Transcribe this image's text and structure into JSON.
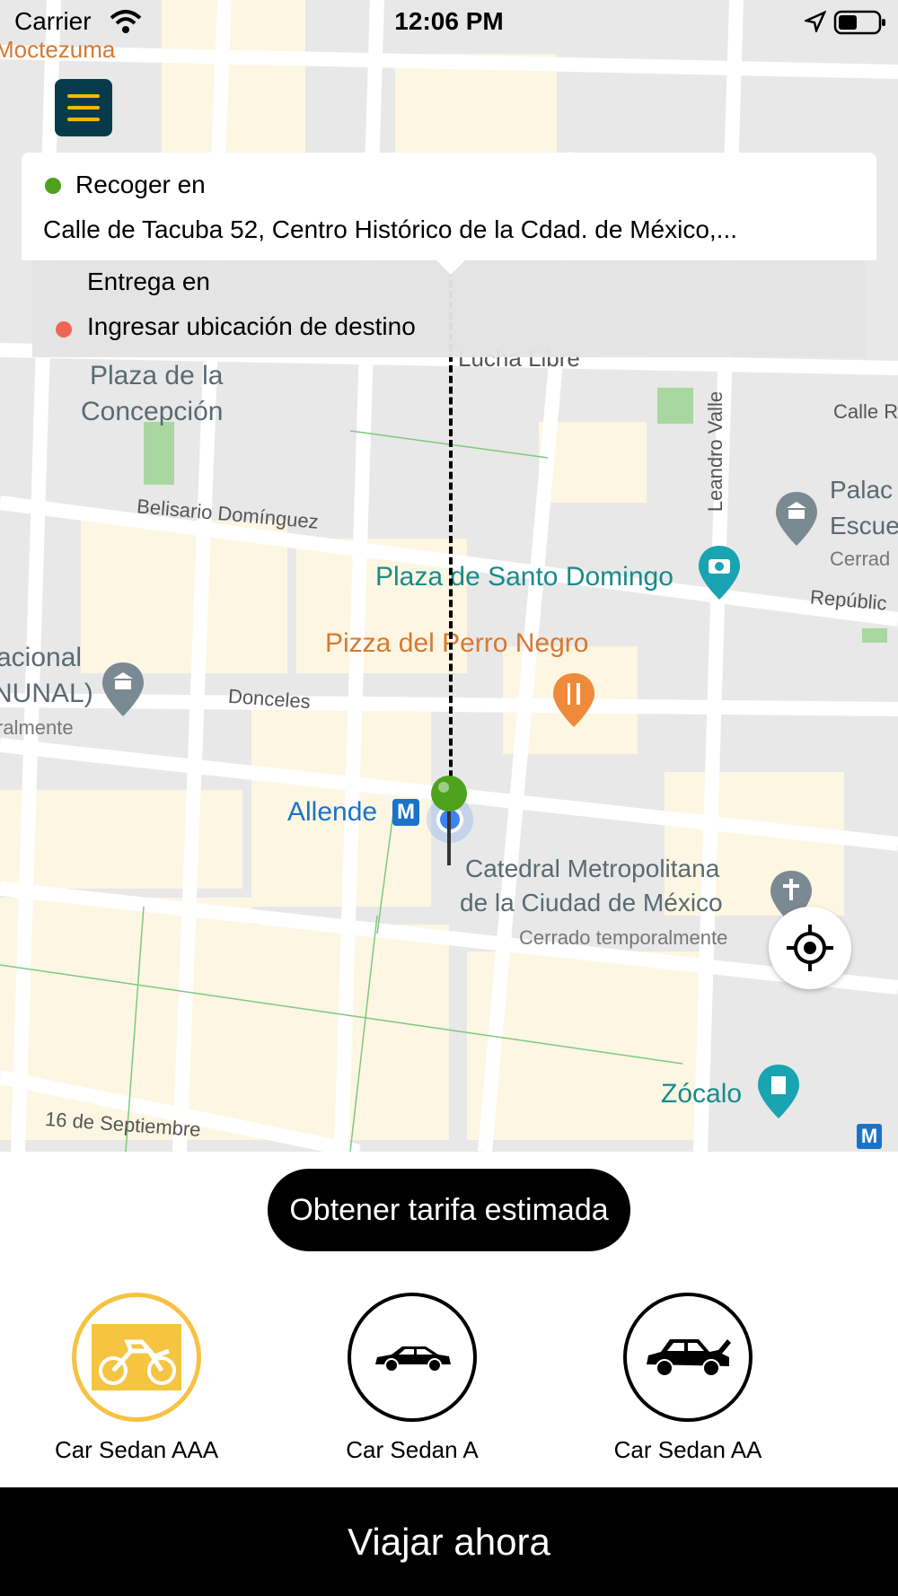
{
  "status_bar": {
    "carrier": "Carrier",
    "time": "12:06 PM"
  },
  "pickup": {
    "title": "Recoger en",
    "address": "Calle de Tacuba 52, Centro Histórico de la Cdad. de México,..."
  },
  "dropoff": {
    "title": "Entrega en",
    "placeholder": "Ingresar ubicación de destino"
  },
  "map_labels": {
    "moctezuma": "Moctezuma",
    "plaza_concepcion_1": "Plaza de la",
    "plaza_concepcion_2": "Concepción",
    "belisario": "Belisario Domínguez",
    "lucha_libre": "Lucha Libre",
    "leandro_valle": "Leandro Valle",
    "calle_r": "Calle R",
    "palacio_1": "Palac",
    "palacio_2": "Escue",
    "palacio_3": "Cerrad",
    "republica": "Repúblic",
    "santo_domingo": "Plaza de Santo Domingo",
    "pizza": "Pizza del Perro Negro",
    "nacional_1": "acional",
    "nacional_2": "NUNAL)",
    "nacional_3": "ralmente",
    "donceles": "Donceles",
    "allende": "Allende",
    "metro_m": "M",
    "catedral_1": "Catedral Metropolitana",
    "catedral_2": "de la Ciudad de México",
    "catedral_3": "Cerrado temporalmente",
    "zocalo": "Zócalo",
    "sep16": "16 de Septiembre"
  },
  "fare_button": "Obtener tarifa estimada",
  "vehicles": [
    {
      "label": "Car Sedan AAA",
      "selected": true,
      "icon": "motorcycle-icon"
    },
    {
      "label": "Car Sedan A",
      "selected": false,
      "icon": "sedan-icon"
    },
    {
      "label": "Car Sedan AA",
      "selected": false,
      "icon": "sedan-trunk-icon"
    }
  ],
  "ride_now_button": "Viajar ahora",
  "colors": {
    "accent": "#f5b800",
    "menu_bg": "#073b4c",
    "pickup_dot": "#4ea21e",
    "dropoff_dot": "#f06455",
    "pin_green": "#4ea21e",
    "user_blue": "#3b82f6"
  }
}
